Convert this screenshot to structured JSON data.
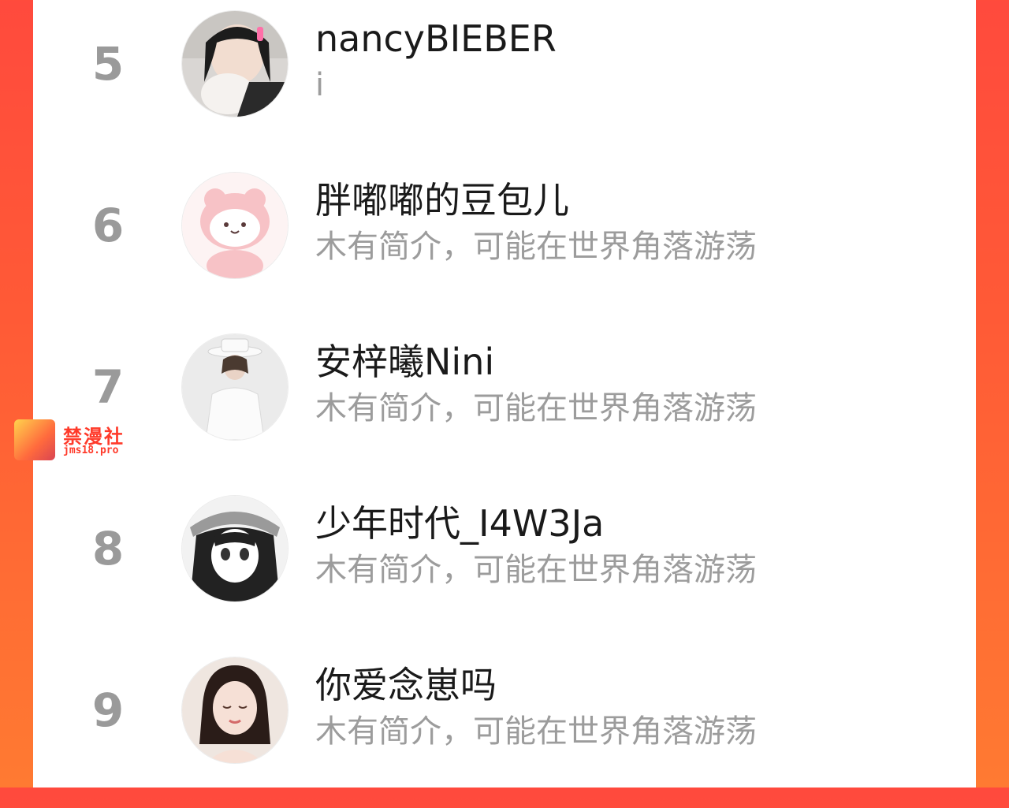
{
  "users": [
    {
      "rank": "5",
      "name": "nancyBIEBER",
      "bio": "i",
      "avatar_icon": "avatar-photo-girl-cat"
    },
    {
      "rank": "6",
      "name": "胖嘟嘟的豆包儿",
      "bio": "木有简介，可能在世界角落游荡",
      "avatar_icon": "avatar-pink-bear"
    },
    {
      "rank": "7",
      "name": "安梓曦Nini",
      "bio": "木有简介，可能在世界角落游荡",
      "avatar_icon": "avatar-photo-white-hat"
    },
    {
      "rank": "8",
      "name": "少年时代_I4W3Ja",
      "bio": "木有简介，可能在世界角落游荡",
      "avatar_icon": "avatar-anime-girl"
    },
    {
      "rank": "9",
      "name": "你爱念崽吗",
      "bio": "木有简介，可能在世界角落游荡",
      "avatar_icon": "avatar-photo-girl"
    }
  ],
  "watermark": {
    "title": "禁漫社",
    "url": "jms18.pro"
  },
  "colors": {
    "background": "#ff4a3d",
    "rank": "#9a9a9a",
    "bio": "#9c9c9c"
  }
}
